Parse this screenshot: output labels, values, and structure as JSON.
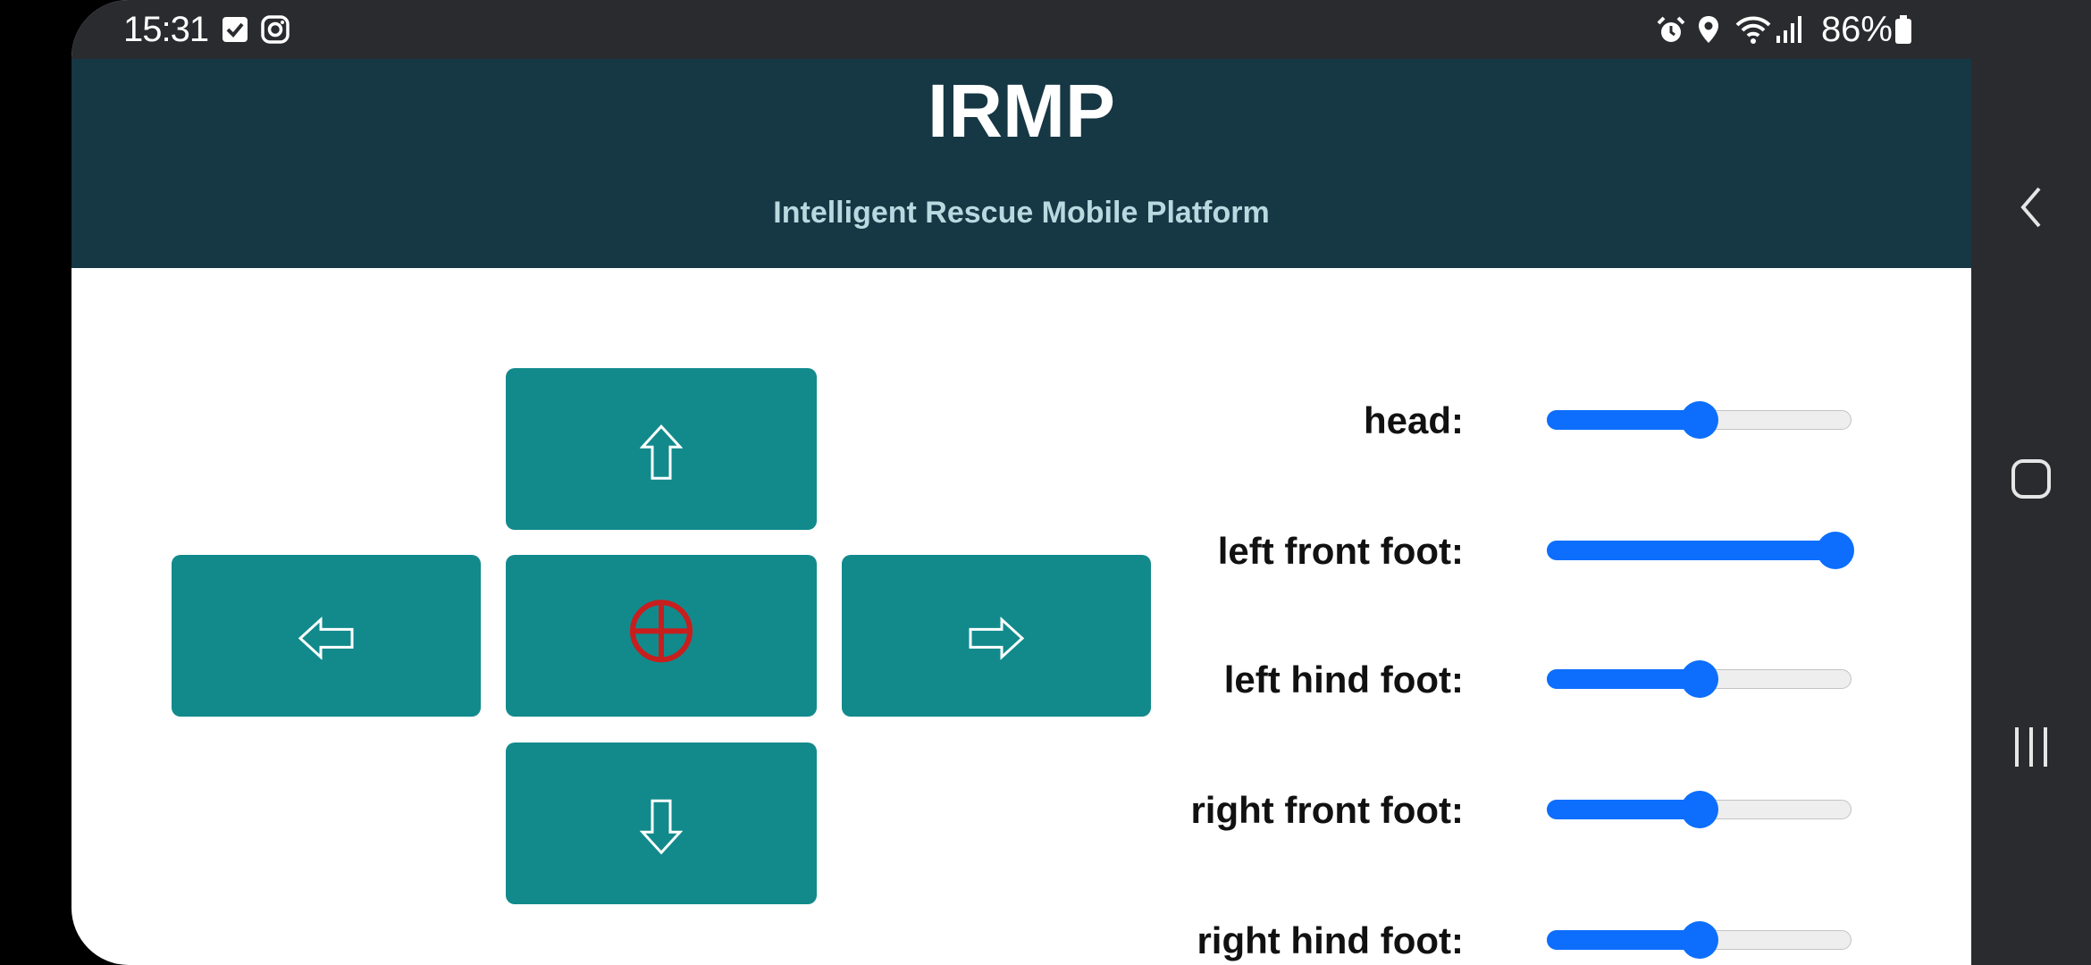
{
  "status_bar": {
    "time": "15:31",
    "battery_percent": "86%",
    "left_icons": [
      "checkbox-notification-icon",
      "instagram-icon"
    ],
    "right_icons": [
      "alarm-icon",
      "location-icon",
      "wifi-icon",
      "signal-icon",
      "battery-icon"
    ]
  },
  "header": {
    "title": "IRMP",
    "subtitle": "Intelligent Rescue Mobile Platform",
    "background": "#163744"
  },
  "controls": {
    "button_color": "#128a8c",
    "stop_icon_color": "#c81e1e",
    "buttons": [
      "up-arrow-icon",
      "left-arrow-icon",
      "stop-crosshair-icon",
      "right-arrow-icon",
      "down-arrow-icon"
    ]
  },
  "sliders": {
    "accent": "#0d6efd",
    "items": [
      {
        "label": "head:",
        "value": 0.5
      },
      {
        "label": "left front foot:",
        "value": 0.95
      },
      {
        "label": "left hind foot:",
        "value": 0.5
      },
      {
        "label": "right front foot:",
        "value": 0.5
      },
      {
        "label": "right hind foot:",
        "value": 0.5
      }
    ]
  },
  "nav_bar": {
    "icons": [
      "back-icon",
      "home-icon",
      "recents-icon"
    ]
  }
}
